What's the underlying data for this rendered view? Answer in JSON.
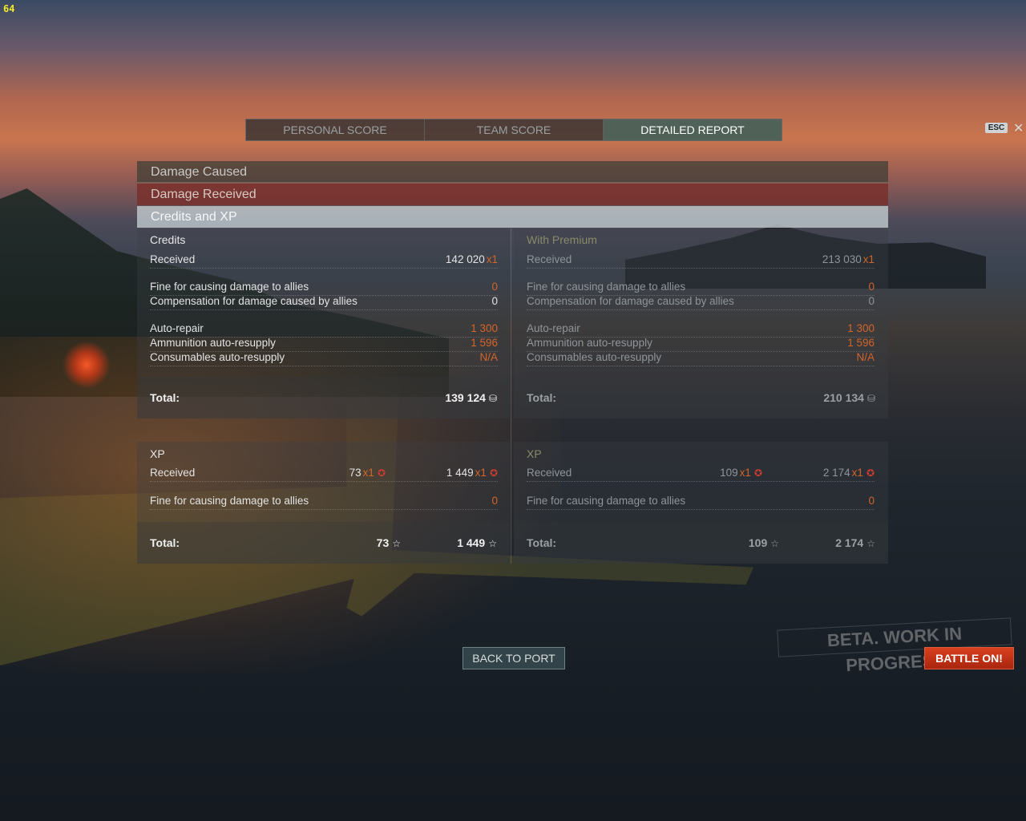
{
  "fps_counter": "64",
  "tabs": [
    {
      "label": "PERSONAL SCORE",
      "active": false
    },
    {
      "label": "TEAM SCORE",
      "active": false
    },
    {
      "label": "DETAILED REPORT",
      "active": true
    }
  ],
  "esc_label": "ESC",
  "sections": {
    "damage_caused": "Damage Caused",
    "damage_received": "Damage Received",
    "credits_and_xp": "Credits and XP"
  },
  "credits": {
    "title": "Credits",
    "received": {
      "label": "Received",
      "value": "142 020",
      "multiplier": "x1"
    },
    "fine": {
      "label": "Fine for causing damage to allies",
      "value": "0"
    },
    "compensation": {
      "label": "Compensation for damage caused by allies",
      "value": "0"
    },
    "auto_repair": {
      "label": "Auto-repair",
      "value": "1 300"
    },
    "ammo": {
      "label": "Ammunition auto-resupply",
      "value": "1 596"
    },
    "consumables": {
      "label": "Consumables auto-resupply",
      "value": "N/A"
    },
    "total": {
      "label": "Total:",
      "value": "139 124"
    }
  },
  "premium": {
    "title": "With Premium",
    "received": {
      "label": "Received",
      "value": "213 030",
      "multiplier": "x1"
    },
    "fine": {
      "label": "Fine for causing damage to allies",
      "value": "0"
    },
    "compensation": {
      "label": "Compensation for damage caused by allies",
      "value": "0"
    },
    "auto_repair": {
      "label": "Auto-repair",
      "value": "1 300"
    },
    "ammo": {
      "label": "Ammunition auto-resupply",
      "value": "1 596"
    },
    "consumables": {
      "label": "Consumables auto-resupply",
      "value": "N/A"
    },
    "total": {
      "label": "Total:",
      "value": "210 134"
    }
  },
  "xp": {
    "title": "XP",
    "received": {
      "label": "Received",
      "ship_value": "73",
      "ship_mult": "x1",
      "value": "1 449",
      "multiplier": "x1"
    },
    "fine": {
      "label": "Fine for causing damage to allies",
      "value": "0"
    },
    "total": {
      "label": "Total:",
      "ship_value": "73",
      "value": "1 449"
    }
  },
  "xp_premium": {
    "title": "XP",
    "received": {
      "label": "Received",
      "ship_value": "109",
      "ship_mult": "x1",
      "value": "2 174",
      "multiplier": "x1"
    },
    "fine": {
      "label": "Fine for causing damage to allies",
      "value": "0"
    },
    "total": {
      "label": "Total:",
      "ship_value": "109",
      "value": "2 174"
    }
  },
  "buttons": {
    "back_to_port": "BACK TO PORT",
    "battle_on": "BATTLE ON!"
  },
  "watermark": "BETA. WORK IN PROGRESS",
  "icons": {
    "credit": "credit-icon",
    "xp_star": "star-icon",
    "elite_xp": "elite-xp-icon",
    "close": "close-icon"
  },
  "colors": {
    "orange_penalty": "#d2652a",
    "battle_button": "#c5321a",
    "fps": "#f2ea29"
  }
}
